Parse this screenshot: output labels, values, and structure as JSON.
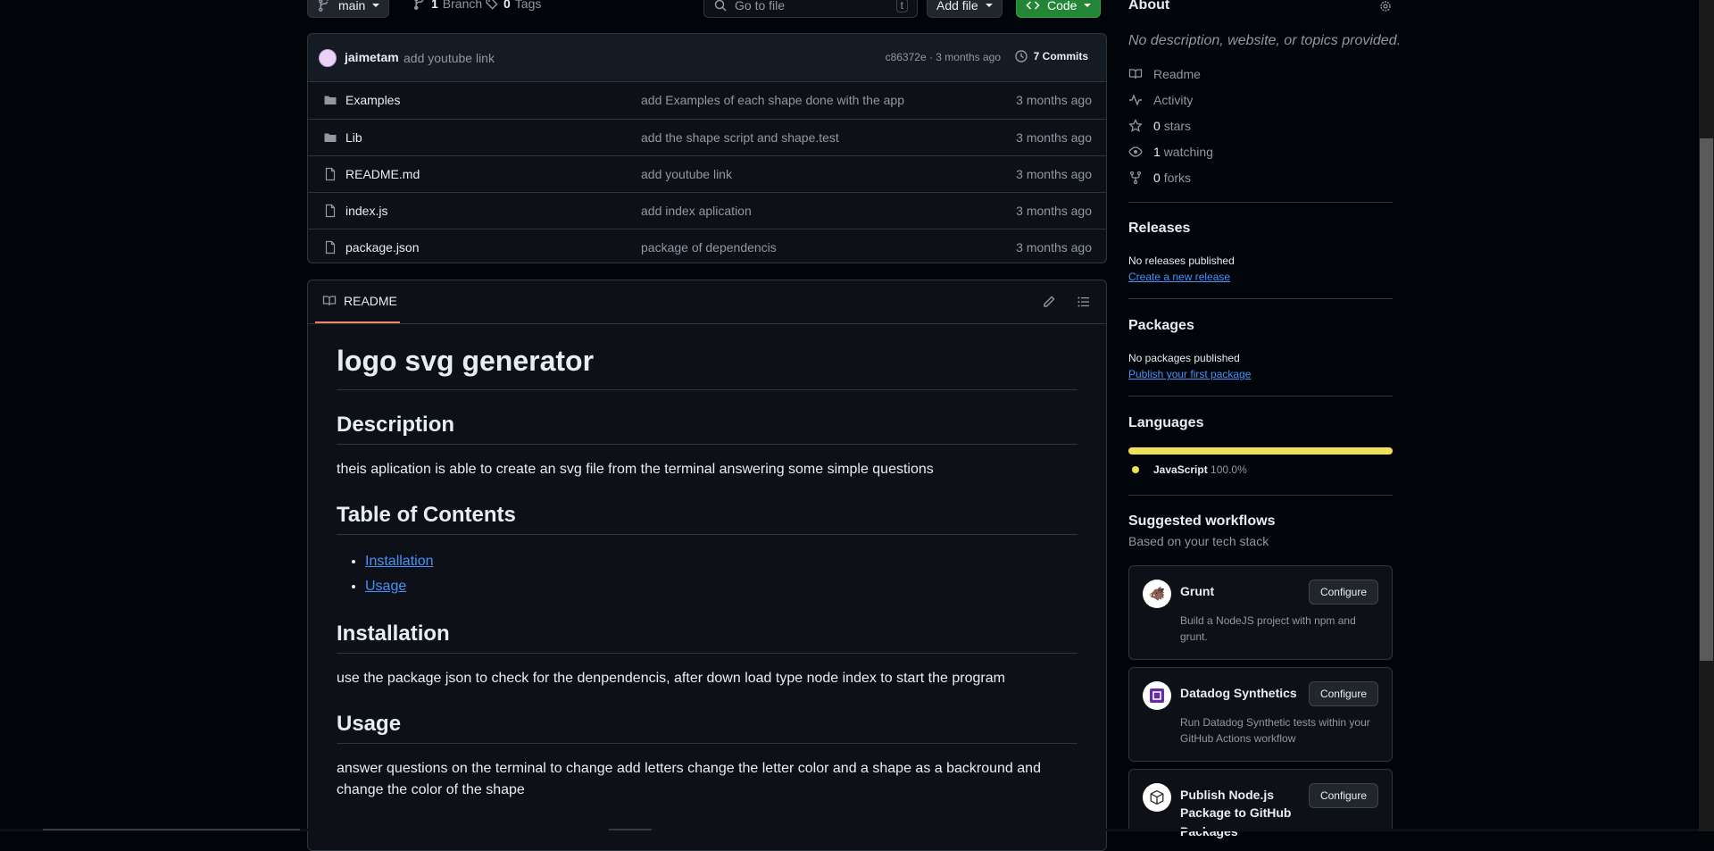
{
  "toolbar": {
    "branch_button": "main",
    "branches_count": "1",
    "branches_label": "Branch",
    "tags_count": "0",
    "tags_label": "Tags",
    "go_to_file_placeholder": "Go to file",
    "go_to_file_shortcut": "t",
    "add_file_label": "Add file",
    "code_label": "Code"
  },
  "commit_bar": {
    "author": "jaimetam",
    "message": "add youtube link",
    "hash_time": "c86372e · 3 months ago",
    "commits_label": "7 Commits"
  },
  "files": [
    {
      "name": "Examples",
      "type": "folder",
      "message": "add Examples of each shape done with the app",
      "age": "3 months ago"
    },
    {
      "name": "Lib",
      "type": "folder",
      "message": "add the shape script and shape.test",
      "age": "3 months ago"
    },
    {
      "name": "README.md",
      "type": "file",
      "message": "add youtube link",
      "age": "3 months ago"
    },
    {
      "name": "index.js",
      "type": "file",
      "message": "add index aplication",
      "age": "3 months ago"
    },
    {
      "name": "package.json",
      "type": "file",
      "message": "package of dependencis",
      "age": "3 months ago"
    }
  ],
  "readme": {
    "tab_label": "README",
    "title": "logo svg generator",
    "description_heading": "Description",
    "description_text": "theis aplication is able to create an svg file from the terminal answering some simple questions",
    "toc_heading": "Table of Contents",
    "toc_items": [
      "Installation",
      "Usage"
    ],
    "installation_heading": "Installation",
    "installation_text": "use the package json to check for the denpendencis, after down load type node index to start the program",
    "usage_heading": "Usage",
    "usage_text": "answer questions on the terminal to change add letters change the letter color and a shape as a backround and change the color of the shape"
  },
  "about": {
    "heading": "About",
    "description": "No description, website, or topics provided.",
    "readme_label": "Readme",
    "activity_label": "Activity",
    "stars_count": "0",
    "stars_label": "stars",
    "watching_count": "1",
    "watching_label": "watching",
    "forks_count": "0",
    "forks_label": "forks"
  },
  "releases": {
    "heading": "Releases",
    "none_text": "No releases published",
    "create_link": "Create a new release"
  },
  "packages": {
    "heading": "Packages",
    "none_text": "No packages published",
    "publish_link": "Publish your first package"
  },
  "languages": {
    "heading": "Languages",
    "items": [
      {
        "name": "JavaScript",
        "percent": "100.0%",
        "color": "#f1e05a",
        "fraction": 1.0
      }
    ]
  },
  "workflows": {
    "heading": "Suggested workflows",
    "subheading": "Based on your tech stack",
    "items": [
      {
        "title": "Grunt",
        "description": "Build a NodeJS project with npm and grunt.",
        "button": "Configure"
      },
      {
        "title": "Datadog Synthetics",
        "description": "Run Datadog Synthetic tests within your GitHub Actions workflow",
        "button": "Configure"
      },
      {
        "title": "Publish Node.js Package to GitHub Packages",
        "description": "",
        "button": "Configure"
      }
    ]
  },
  "colors": {
    "background": "#010409",
    "panel": "#0d1117",
    "border": "#30363d",
    "accent_link": "#4493f8",
    "code_button": "#238636",
    "tab_underline": "#f78166"
  }
}
